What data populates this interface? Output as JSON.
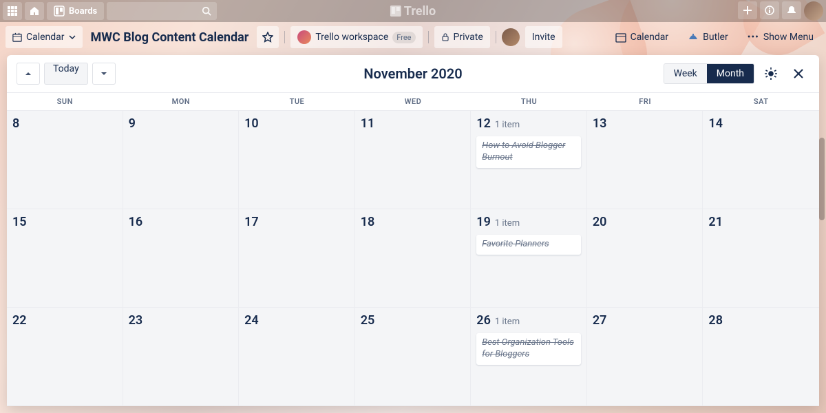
{
  "topbar": {
    "boards_label": "Boards",
    "logo_text": "Trello"
  },
  "boardbar": {
    "view_switch": "Calendar",
    "board_title": "MWC Blog Content Calendar",
    "workspace": "Trello workspace",
    "workspace_tier": "Free",
    "visibility": "Private",
    "invite": "Invite",
    "calendar_btn": "Calendar",
    "butler_btn": "Butler",
    "show_menu": "Show Menu"
  },
  "calendar": {
    "today": "Today",
    "title": "November 2020",
    "week": "Week",
    "month": "Month",
    "days_of_week": [
      "SUN",
      "MON",
      "TUE",
      "WED",
      "THU",
      "FRI",
      "SAT"
    ],
    "weeks": [
      [
        {
          "n": "8"
        },
        {
          "n": "9"
        },
        {
          "n": "10"
        },
        {
          "n": "11"
        },
        {
          "n": "12",
          "count": "1 item",
          "card": "How to Avoid Blogger Burnout"
        },
        {
          "n": "13"
        },
        {
          "n": "14"
        }
      ],
      [
        {
          "n": "15"
        },
        {
          "n": "16"
        },
        {
          "n": "17"
        },
        {
          "n": "18"
        },
        {
          "n": "19",
          "count": "1 item",
          "card": "Favorite Planners"
        },
        {
          "n": "20"
        },
        {
          "n": "21"
        }
      ],
      [
        {
          "n": "22"
        },
        {
          "n": "23"
        },
        {
          "n": "24"
        },
        {
          "n": "25"
        },
        {
          "n": "26",
          "count": "1 item",
          "card": "Best Organization Tools for Bloggers"
        },
        {
          "n": "27"
        },
        {
          "n": "28"
        }
      ]
    ]
  }
}
